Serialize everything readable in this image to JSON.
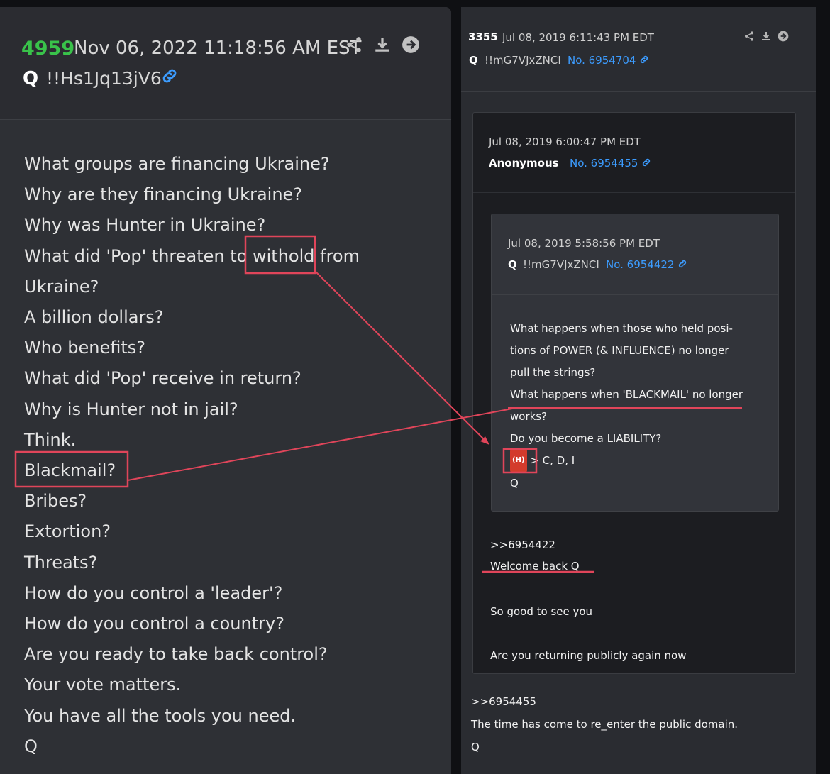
{
  "left_post": {
    "number": "4959",
    "date": "Nov 06, 2022 11:18:56 AM EST",
    "author": "Q",
    "tripcode": "!!Hs1Jq13jV6",
    "lines": [
      "What groups are financing Ukraine?",
      "Why are they financing Ukraine?",
      "Why was Hunter in Ukraine?",
      "What did 'Pop' threaten to withold from",
      "Ukraine?",
      "A billion dollars?",
      "Who benefits?",
      "What did 'Pop' receive in return?",
      "Why is Hunter not in jail?",
      "Think.",
      "Blackmail?",
      "Bribes?",
      "Extortion?",
      "Threats?",
      "How do you control a 'leader'?",
      "How do you control a country?",
      "Are you ready to take back control?",
      "Your vote matters.",
      "You have all the tools you need.",
      "Q"
    ],
    "icons": [
      "share-icon",
      "download-icon",
      "arrow-right-icon",
      "link-icon"
    ]
  },
  "right_post": {
    "number": "3355",
    "date": "Jul 08, 2019 6:11:43 PM EDT",
    "author": "Q",
    "tripcode": "!!mG7VJxZNCI",
    "post_no": "No. 6954704",
    "reply": {
      "date": "Jul 08, 2019 6:00:47 PM EDT",
      "author": "Anonymous",
      "post_no": "No. 6954455",
      "quote": {
        "date": "Jul 08, 2019 5:58:56 PM EDT",
        "author": "Q",
        "tripcode": "!!mG7VJxZNCI",
        "post_no": "No. 6954422",
        "lines": [
          "What happens when those who held posi-",
          "tions of POWER (& INFLUENCE) no longer",
          "pull the strings?",
          "What happens when 'BLACKMAIL' no longer",
          "works?",
          "Do you become a LIABILITY?"
        ],
        "badge": "(H)",
        "badge_suffix": "> C, D, I",
        "signature": "Q"
      },
      "body": {
        "ref": ">>6954422",
        "line1": "Welcome back Q",
        "line2": "So good to see you",
        "line3": "Are you returning publicly again now"
      }
    },
    "body": {
      "ref": ">>6954455",
      "line1": "The time has come to re_enter the public domain.",
      "signature": "Q"
    }
  },
  "colors": {
    "post_number": "#39c24a",
    "link": "#3c9cff",
    "annotation": "#e0455a"
  }
}
